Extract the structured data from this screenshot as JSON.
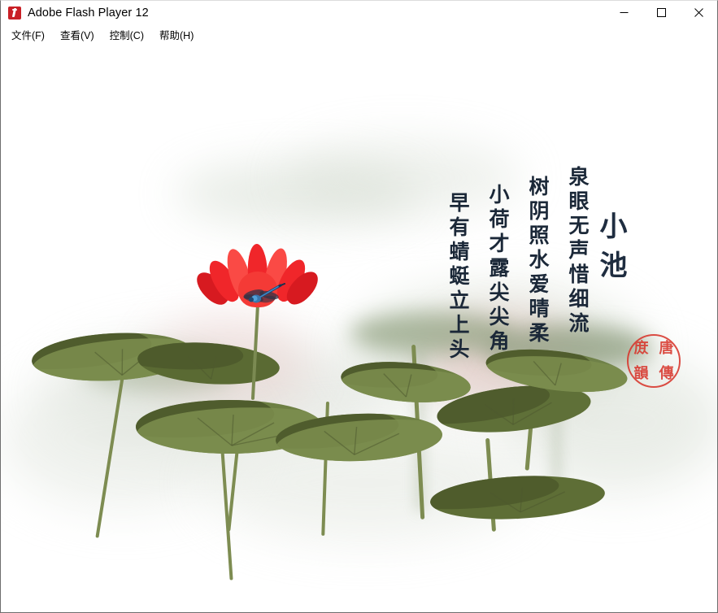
{
  "window": {
    "title": "Adobe Flash Player 12",
    "icon": "flash-player-icon",
    "controls": {
      "minimize": "minimize-icon",
      "maximize": "maximize-icon",
      "close": "close-icon"
    }
  },
  "menubar": {
    "items": [
      {
        "label": "文件(F)"
      },
      {
        "label": "查看(V)"
      },
      {
        "label": "控制(C)"
      },
      {
        "label": "帮助(H)"
      }
    ]
  },
  "artwork": {
    "poem": {
      "title": "小池",
      "lines": [
        "泉眼无声惜细流",
        "树阴照水爱晴柔",
        "小荷才露尖尖角",
        "早有蜻蜓立上头"
      ]
    },
    "seal": {
      "characters": [
        "庻",
        "唐",
        "韻",
        "傳"
      ]
    },
    "colors": {
      "lotus_petal": "#f0262a",
      "lotus_petal_light": "#fa4a45",
      "lotus_petal_dark": "#d71a20",
      "leaf": "#6d7f43",
      "leaf_dark": "#4e5b2c",
      "stem": "#7d8c51",
      "dragonfly_body": "#2f6fa8",
      "dragonfly_wing": "#2a3246",
      "poem_ink": "#1b2838",
      "seal_red": "#d8362c",
      "background": "#ffffff"
    },
    "scene": {
      "subject": "lotus pond ink-wash painting",
      "elements": [
        "red lotus flower",
        "blue dragonfly",
        "lotus pads",
        "stems",
        "vertical poem",
        "red seal"
      ]
    }
  }
}
